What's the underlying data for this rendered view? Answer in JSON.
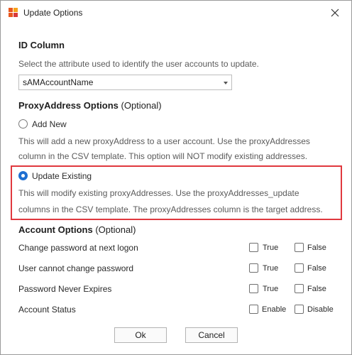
{
  "window": {
    "title": "Update Options",
    "icon": "app-logo-icon",
    "close_icon": "close-icon"
  },
  "id_column": {
    "heading": "ID Column",
    "help": "Select the attribute used to identify the user accounts to update.",
    "selected_attribute": "sAMAccountName"
  },
  "proxy": {
    "heading": "ProxyAddress Options",
    "optional": "(Optional)",
    "add_new": {
      "label": "Add New",
      "checked": false,
      "help_line1": "This will add a new proxyAddress to a user account. Use the proxyAddresses",
      "help_line2": "column in the CSV template. This option will NOT modify existing addresses."
    },
    "update_existing": {
      "label": "Update Existing",
      "checked": true,
      "help_line1": "This will modify existing proxyAddresses. Use the proxyAddresses_update",
      "help_line2": "columns in the CSV template. The proxyAddresses column is the target address."
    },
    "highlight_color": "#e0383e"
  },
  "account": {
    "heading": "Account Options",
    "optional": "(Optional)",
    "rows": [
      {
        "label": "Change password at next logon",
        "opt1": "True",
        "opt2": "False"
      },
      {
        "label": "User cannot change password",
        "opt1": "True",
        "opt2": "False"
      },
      {
        "label": "Password Never Expires",
        "opt1": "True",
        "opt2": "False"
      },
      {
        "label": "Account Status",
        "opt1": "Enable",
        "opt2": "Disable"
      }
    ]
  },
  "buttons": {
    "ok": "Ok",
    "cancel": "Cancel"
  },
  "colors": {
    "accent": "#1f6fd1",
    "highlight": "#e0383e"
  }
}
